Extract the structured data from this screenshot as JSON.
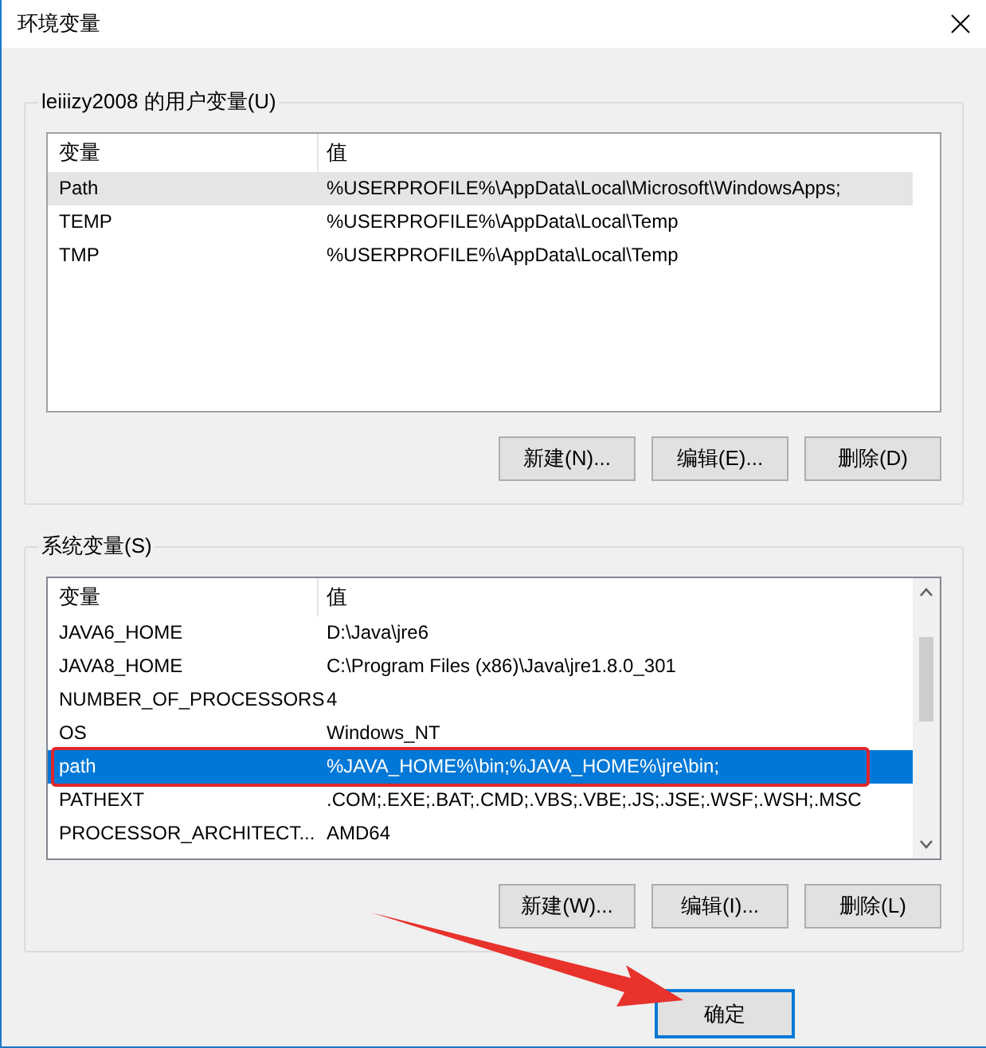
{
  "window": {
    "title": "环境变量"
  },
  "user_variables": {
    "title": "leiiizy2008 的用户变量(U)",
    "focused": false,
    "columns": [
      "变量",
      "值"
    ],
    "rows": [
      {
        "name": "Path",
        "value": "%USERPROFILE%\\AppData\\Local\\Microsoft\\WindowsApps;",
        "selected": true,
        "highlighted": false
      },
      {
        "name": "TEMP",
        "value": "%USERPROFILE%\\AppData\\Local\\Temp",
        "selected": false,
        "highlighted": false
      },
      {
        "name": "TMP",
        "value": "%USERPROFILE%\\AppData\\Local\\Temp",
        "selected": false,
        "highlighted": false
      }
    ],
    "buttons": [
      "新建(N)...",
      "编辑(E)...",
      "删除(D)"
    ]
  },
  "system_variables": {
    "title": "系统变量(S)",
    "focused": true,
    "columns": [
      "变量",
      "值"
    ],
    "rows": [
      {
        "name": "JAVA6_HOME",
        "value": "D:\\Java\\jre6",
        "selected": false,
        "highlighted": false
      },
      {
        "name": "JAVA8_HOME",
        "value": "C:\\Program Files (x86)\\Java\\jre1.8.0_301",
        "selected": false,
        "highlighted": false
      },
      {
        "name": "NUMBER_OF_PROCESSORS",
        "value": "4",
        "selected": false,
        "highlighted": false
      },
      {
        "name": "OS",
        "value": "Windows_NT",
        "selected": false,
        "highlighted": false
      },
      {
        "name": "path",
        "value": "%JAVA_HOME%\\bin;%JAVA_HOME%\\jre\\bin;",
        "selected": true,
        "highlighted": true
      },
      {
        "name": "PATHEXT",
        "value": ".COM;.EXE;.BAT;.CMD;.VBS;.VBE;.JS;.JSE;.WSF;.WSH;.MSC",
        "selected": false,
        "highlighted": false
      },
      {
        "name": "PROCESSOR_ARCHITECT...",
        "value": "AMD64",
        "selected": false,
        "highlighted": false
      }
    ],
    "buttons": [
      "新建(W)...",
      "编辑(I)...",
      "删除(L)"
    ]
  },
  "dialog_buttons": [
    {
      "label": "确定",
      "default": true
    }
  ]
}
